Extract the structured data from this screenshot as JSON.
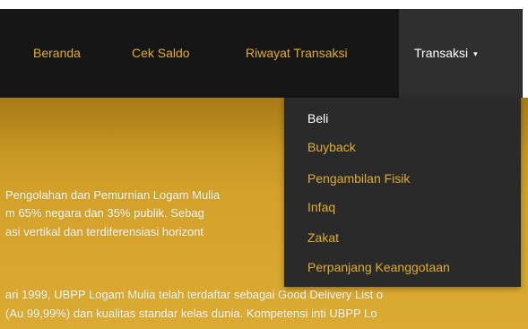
{
  "navbar": {
    "items": [
      {
        "label": "Beranda"
      },
      {
        "label": "Cek Saldo"
      },
      {
        "label": "Riwayat Transaksi"
      },
      {
        "label": "Transaksi",
        "caret": "▾",
        "active": true
      }
    ]
  },
  "dropdown": {
    "items": [
      {
        "label": "Beli",
        "active": true
      },
      {
        "label": "Buyback"
      },
      {
        "label": "Pengambilan Fisik"
      },
      {
        "label": "Infaq"
      },
      {
        "label": "Zakat"
      },
      {
        "label": "Perpanjang Keanggotaan"
      }
    ]
  },
  "content": {
    "lines": [
      "Pengolahan dan Pemurnian Logam Mulia",
      "m 65% negara dan 35% publik. Sebag",
      "asi vertikal dan terdiferensiasi horizont",
      "ari 1999, UBPP Logam Mulia telah terdaftar sebagai Good Delivery List o",
      "(Au 99,99%) dan kualitas standar kelas dunia. Kompetensi inti UBPP Lo"
    ]
  },
  "colors": {
    "navbar_bg": "#161616",
    "nav_active_bg": "#2f2f2f",
    "accent_gold": "#e1ad2d",
    "gold_band": "#d4a22a",
    "dropdown_bg": "#2a2a2a",
    "text_white": "#ffffff"
  }
}
